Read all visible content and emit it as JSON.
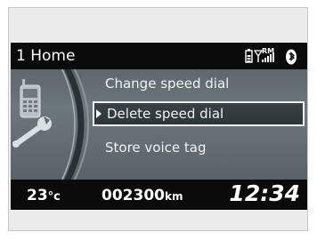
{
  "header": {
    "title": "1 Home",
    "rm_label": "RM",
    "icons": [
      "phone-battery-icon",
      "signal-strength-icon",
      "bluetooth-icon"
    ]
  },
  "menu": {
    "items": [
      {
        "label": "Change speed dial",
        "selected": false
      },
      {
        "label": "Delete speed dial",
        "selected": true
      },
      {
        "label": "Store voice tag",
        "selected": false
      }
    ]
  },
  "left_panel": {
    "icon": "phone-settings-icon"
  },
  "footer": {
    "temperature": "23",
    "temperature_unit": "°c",
    "odometer": "002300",
    "odometer_unit": "km",
    "clock": "12:34"
  },
  "colors": {
    "screen_bg": "#0b0b0b",
    "menu_bg": "#6c777d",
    "highlight_border": "#f4f4f4",
    "text": "#ffffff"
  }
}
